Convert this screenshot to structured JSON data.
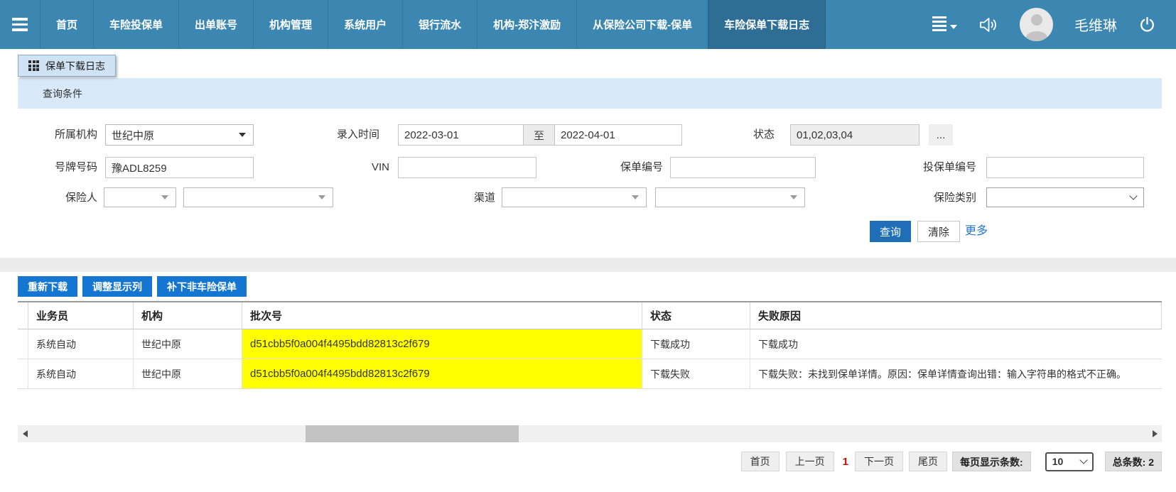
{
  "navbar": {
    "items": [
      "首页",
      "车险投保单",
      "出单账号",
      "机构管理",
      "系统用户",
      "银行流水",
      "机构-郑汴激励",
      "从保险公司下载-保单",
      "车险保单下载日志"
    ],
    "active_item": "车险保单下载日志",
    "username": "毛维琳"
  },
  "tab": {
    "label": "保单下载日志"
  },
  "query": {
    "panel_title": "查询条件",
    "org": {
      "label": "所属机构",
      "value": "世纪中原"
    },
    "entry_time": {
      "label": "录入时间",
      "from": "2022-03-01",
      "to_separator": "至",
      "to": "2022-04-01"
    },
    "status": {
      "label": "状态",
      "value": "01,02,03,04",
      "more_button": "..."
    },
    "plate": {
      "label": "号牌号码",
      "value": "豫ADL8259"
    },
    "vin": {
      "label": "VIN",
      "value": ""
    },
    "policy_no": {
      "label": "保单编号",
      "value": ""
    },
    "proposal_no": {
      "label": "投保单编号",
      "value": ""
    },
    "insurer": {
      "label": "保险人"
    },
    "channel": {
      "label": "渠道"
    },
    "insurance_type": {
      "label": "保险类别"
    },
    "buttons": {
      "search": "查询",
      "clear": "清除",
      "more": "更多"
    }
  },
  "toolbar": {
    "redownload": "重新下载",
    "adjust_columns": "调整显示列",
    "download_non_auto": "补下非车险保单"
  },
  "table": {
    "headers": [
      "业务员",
      "机构",
      "批次号",
      "状态",
      "失败原因"
    ],
    "rows": [
      {
        "cells": [
          "系统自动",
          "世纪中原",
          "d51cbb5f0a004f4495bdd82813c2f679",
          "下载成功",
          "下载成功"
        ]
      },
      {
        "cells": [
          "系统自动",
          "世纪中原",
          "d51cbb5f0a004f4495bdd82813c2f679",
          "下载失败",
          "下载失败：未找到保单详情。原因：保单详情查询出错：输入字符串的格式不正确。"
        ]
      }
    ],
    "highlight_color": "#ffff00"
  },
  "pagination": {
    "first": "首页",
    "prev": "上一页",
    "current_page": "1",
    "next": "下一页",
    "last": "尾页",
    "per_page_label": "每页显示条数:",
    "per_page_value": "10",
    "total": "总条数: 2"
  },
  "colors": {
    "navbar": "#3c87b2",
    "navbar_active": "#2e6e94",
    "accent_blue": "#1576d2",
    "search_blue": "#1e6fb8",
    "query_band": "#d8e9f9",
    "tab_bg": "#cfe3f4",
    "highlight": "#ffff00",
    "current_page_red": "#e60000"
  },
  "icons": {
    "nav_menu": "hamburger-menu",
    "quick_menu": "list-with-caret",
    "sound": "speaker",
    "avatar": "user-silhouette",
    "logout": "power",
    "tab_grid": "grid-3x3",
    "select_caret": "caret-down",
    "scroll_arrows": "triangle-left-right"
  }
}
